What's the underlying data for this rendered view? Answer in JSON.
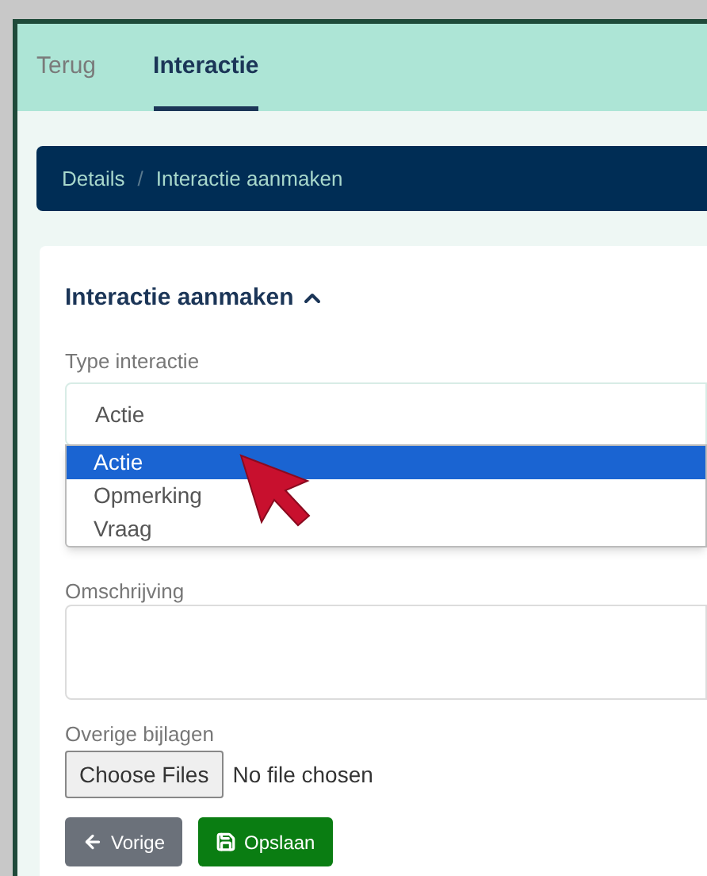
{
  "tabs": [
    {
      "label": "Terug",
      "selected": false
    },
    {
      "label": "Interactie",
      "selected": true
    }
  ],
  "breadcrumb": [
    "Details",
    "Interactie aanmaken"
  ],
  "breadcrumb_separator": "/",
  "section": {
    "title": "Interactie aanmaken",
    "expanded": true
  },
  "type_field": {
    "label": "Type interactie",
    "value": "Actie",
    "options": [
      {
        "label": "Actie",
        "selected": true
      },
      {
        "label": "Opmerking",
        "selected": false
      },
      {
        "label": "Vraag",
        "selected": false
      }
    ]
  },
  "description_field": {
    "label": "Omschrijving"
  },
  "attachments": {
    "label": "Overige bijlagen",
    "button": "Choose Files",
    "status": "No file chosen"
  },
  "buttons": [
    {
      "kind": "back",
      "label": "Vorige"
    },
    {
      "kind": "save",
      "label": "Opslaan"
    }
  ]
}
